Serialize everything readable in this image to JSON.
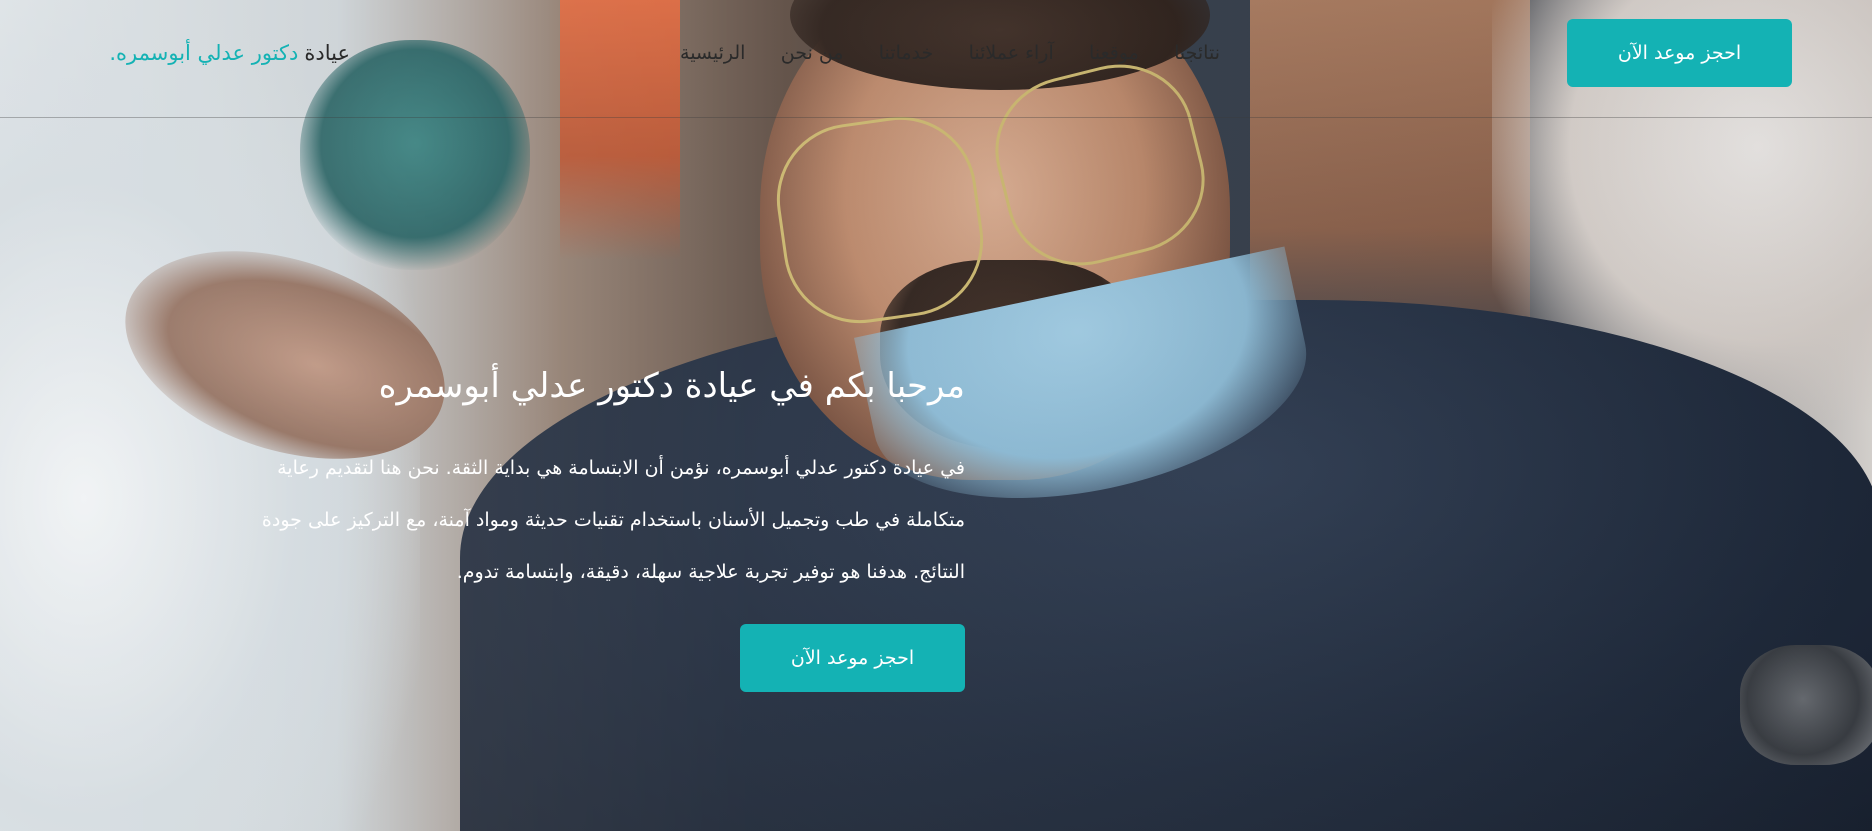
{
  "header": {
    "book_button": "احجز موعد الآن",
    "nav": [
      {
        "label": "نتائجنا"
      },
      {
        "label": "موقعنا"
      },
      {
        "label": "آراء عملائنا"
      },
      {
        "label": "خدماتنا"
      },
      {
        "label": "من نحن"
      },
      {
        "label": "الرئيسية"
      }
    ],
    "logo": {
      "word": "عيادة",
      "name": "دكتور عدلي أبوسمره",
      "dot": "."
    }
  },
  "hero": {
    "title": "مرحبا بكم في عيادة دكتور عدلي أبوسمره",
    "text": "في عيادة دكتور عدلي أبوسمره، نؤمن أن الابتسامة هي بداية الثقة. نحن هنا لتقديم رعاية متكاملة في طب وتجميل الأسنان باستخدام تقنيات حديثة ومواد آمنة، مع التركيز على جودة النتائج. هدفنا هو توفير تجربة علاجية سهلة، دقيقة، وابتسامة تدوم.",
    "book_button": "احجز موعد الآن"
  },
  "colors": {
    "accent": "#14b2b4",
    "text_dark": "#2a2a2a",
    "text_light": "#ffffff"
  },
  "icons": []
}
